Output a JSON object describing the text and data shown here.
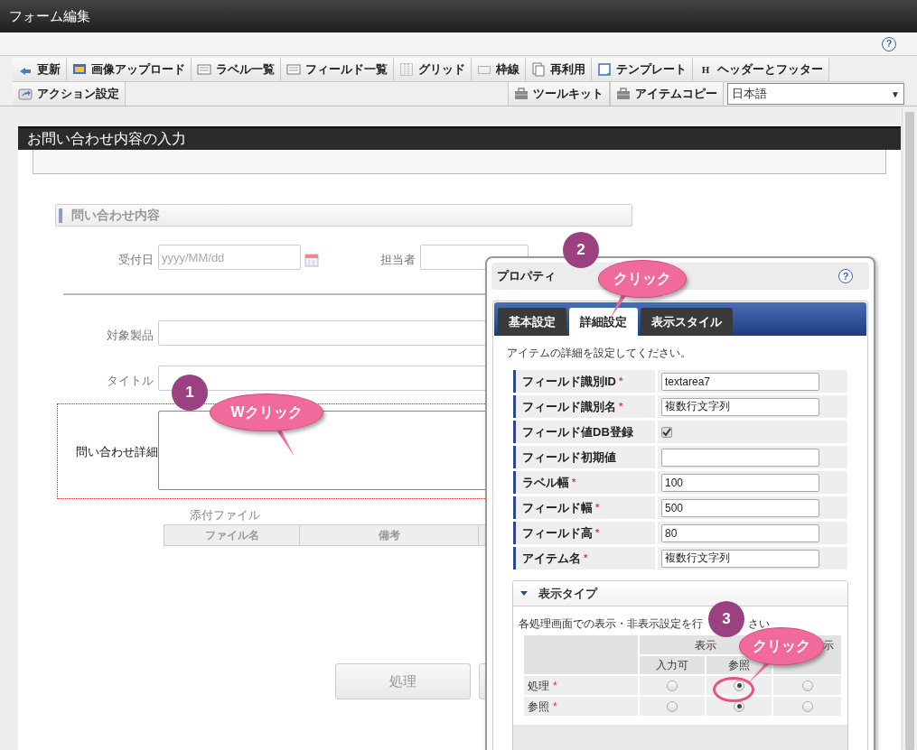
{
  "window": {
    "title": "フォーム編集",
    "help_button": "?"
  },
  "toolbar": {
    "row_1": [
      {
        "label": "更新"
      },
      {
        "label": "画像アップロード"
      },
      {
        "label": "ラベル一覧"
      },
      {
        "label": "フィールド一覧"
      },
      {
        "label": "グリッド"
      },
      {
        "label": "枠線"
      },
      {
        "label": "再利用"
      },
      {
        "label": "テンプレート"
      },
      {
        "label": "ヘッダーとフッター",
        "icon_text": "H"
      }
    ],
    "row_2_left": [
      {
        "label": "アクション設定"
      }
    ],
    "row_2_right": [
      {
        "label": "ツールキット"
      },
      {
        "label": "アイテムコピー"
      }
    ],
    "language_select": {
      "value": "日本語",
      "arrow": "▼"
    }
  },
  "form": {
    "title": "お問い合わせ内容の入力",
    "section": "問い合わせ内容",
    "fields": [
      {
        "label": "受付日",
        "placeholder": "yyyy/MM/dd"
      },
      {
        "label": "担当者"
      },
      {
        "label": "対象製品"
      },
      {
        "label": "タイトル"
      },
      {
        "label": "問い合わせ詳細"
      }
    ],
    "attachment": {
      "label": "添付ファイル",
      "columns": [
        "ファイル名",
        "備考"
      ]
    },
    "buttons": [
      "処理"
    ]
  },
  "properties_panel": {
    "title": "プロパティ",
    "help_button": "?",
    "required_mark": "*",
    "tabs": [
      {
        "label": "基本設定",
        "selected": false
      },
      {
        "label": "詳細設定",
        "selected": true
      },
      {
        "label": "表示スタイル",
        "selected": false
      }
    ],
    "description": "アイテムの詳細を設定してください。",
    "rows": [
      {
        "kind": "text",
        "label": "フィールド識別ID",
        "required": true,
        "value": "textarea7"
      },
      {
        "kind": "text",
        "label": "フィールド識別名",
        "required": true,
        "value": "複数行文字列"
      },
      {
        "kind": "checkbox",
        "label": "フィールド値DB登録",
        "required": false,
        "checked": true
      },
      {
        "kind": "text",
        "label": "フィールド初期値",
        "required": false
      },
      {
        "kind": "text",
        "label": "ラベル幅",
        "required": true,
        "value": "100"
      },
      {
        "kind": "text",
        "label": "フィールド幅",
        "required": true,
        "value": "500"
      },
      {
        "kind": "text",
        "label": "フィールド高",
        "required": true,
        "value": "80"
      },
      {
        "kind": "text",
        "label": "アイテム名",
        "required": true,
        "value": "複数行文字列"
      }
    ],
    "display_type": {
      "title": "表示タイプ",
      "expanded": true,
      "description_start": "各処理画面での表示・非表示設定を行",
      "description_end": "さい",
      "group_header": "表示",
      "column_3_header": "示",
      "columns": [
        "入力可",
        "参照"
      ],
      "rows": [
        {
          "label": "処理",
          "required": true,
          "options": [
            {
              "selected": false
            },
            {
              "selected": true
            },
            {
              "selected": false
            }
          ]
        },
        {
          "label": "参照",
          "required": true,
          "options": [
            {
              "selected": false
            },
            {
              "selected": true
            },
            {
              "selected": false
            }
          ]
        }
      ]
    }
  },
  "callouts": [
    {
      "number": "1",
      "text": "Wクリック"
    },
    {
      "number": "2",
      "text": "クリック"
    },
    {
      "number": "3",
      "text": "クリック"
    }
  ]
}
